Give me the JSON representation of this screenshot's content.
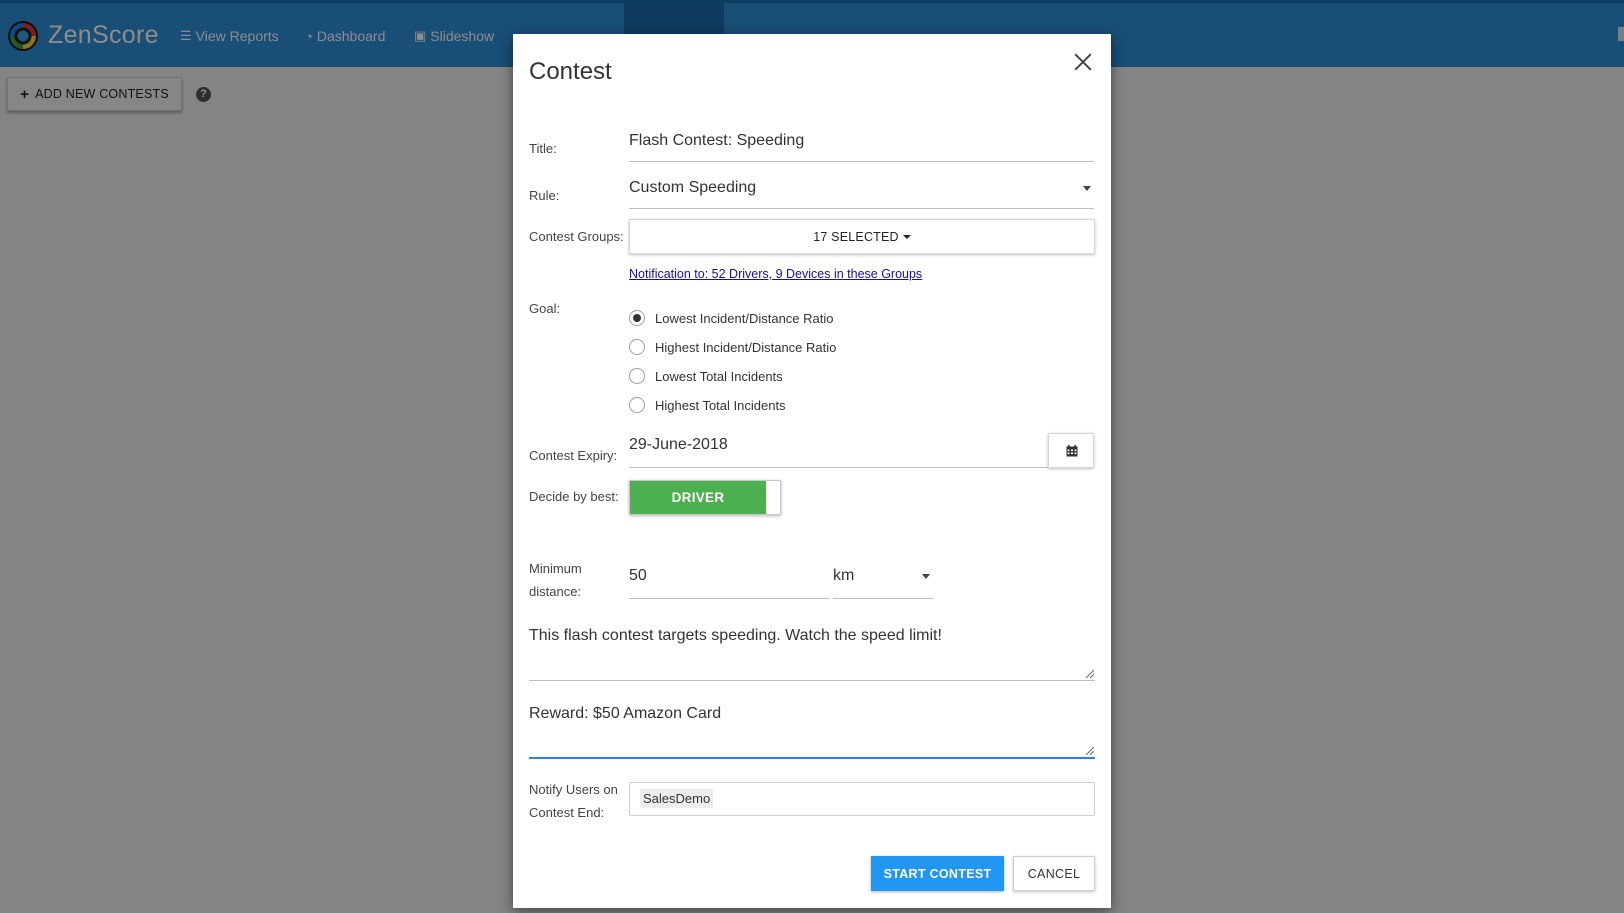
{
  "app": {
    "brand": "ZenScore",
    "nav": [
      {
        "icon": "list-icon",
        "label": "View Reports"
      },
      {
        "icon": "dashboard-icon",
        "label": "Dashboard"
      },
      {
        "icon": "film-icon",
        "label": "Slideshow"
      }
    ],
    "add_button_label": "ADD NEW CONTESTS"
  },
  "modal": {
    "title": "Contest",
    "fields": {
      "title_label": "Title:",
      "title_value": "Flash Contest: Speeding",
      "rule_label": "Rule:",
      "rule_value": "Custom Speeding",
      "groups_label": "Contest Groups:",
      "groups_value": "17 SELECTED",
      "notification_link": "Notification to: 52 Drivers, 9 Devices in these Groups",
      "goal_label": "Goal:",
      "goal_options": [
        {
          "label": "Lowest Incident/Distance Ratio",
          "checked": true
        },
        {
          "label": "Highest Incident/Distance Ratio",
          "checked": false
        },
        {
          "label": "Lowest Total Incidents",
          "checked": false
        },
        {
          "label": "Highest Total Incidents",
          "checked": false
        }
      ],
      "expiry_label": "Contest Expiry:",
      "expiry_value": "29-June-2018",
      "decide_label": "Decide by best:",
      "decide_value": "DRIVER",
      "min_distance_label_line1": "Minimum",
      "min_distance_label_line2": "distance:",
      "min_distance_value": "50",
      "distance_unit": "km",
      "description": "This flash contest targets speeding. Watch the speed limit!",
      "reward": "Reward: $50 Amazon Card",
      "notify_label_line1": "Notify Users on",
      "notify_label_line2": "Contest End:",
      "notify_users": [
        "SalesDemo"
      ]
    },
    "buttons": {
      "start": "START CONTEST",
      "cancel": "CANCEL"
    }
  },
  "colors": {
    "topbar": "#2e8ed8",
    "primary_button": "#2196f3",
    "toggle_on": "#4caf50",
    "link": "#1a0dab"
  }
}
